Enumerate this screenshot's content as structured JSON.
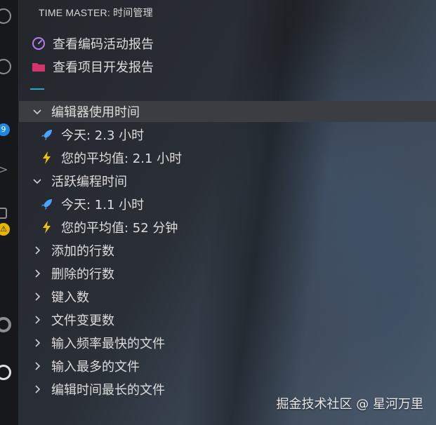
{
  "panel": {
    "title": "TIME MASTER: 时间管理"
  },
  "actions": [
    {
      "label": "查看编码活动报告",
      "icon": "gauge-icon"
    },
    {
      "label": "查看项目开发报告",
      "icon": "folder-icon"
    }
  ],
  "tree": {
    "editor_time": {
      "label": "编辑器使用时间",
      "expanded": true,
      "children": [
        {
          "label": "今天:  2.3 小时",
          "icon": "rocket-icon"
        },
        {
          "label": "您的平均值: 2.1 小时",
          "icon": "lightning-icon"
        }
      ]
    },
    "active_coding": {
      "label": "活跃编程时间",
      "expanded": true,
      "children": [
        {
          "label": "今天:  1.1 小时",
          "icon": "rocket-icon"
        },
        {
          "label": "您的平均值: 52 分钟",
          "icon": "lightning-icon"
        }
      ]
    },
    "collapsed": [
      "添加的行数",
      "删除的行数",
      "键入数",
      "文件变更数",
      "输入频率最快的文件",
      "输入最多的文件",
      "编辑时间最长的文件"
    ]
  },
  "activity_badges": {
    "count_badge": "9",
    "warning_badge": "⚠"
  },
  "watermark": "掘金技术社区 @ 星河万里",
  "colors": {
    "accent_separator": "#2aa6c7",
    "selected_row": "#3a3d42",
    "gauge": "#b77bf0",
    "folder": "#d6336c",
    "rocket": "#4aa3ff",
    "lightning": "#f2c400"
  }
}
